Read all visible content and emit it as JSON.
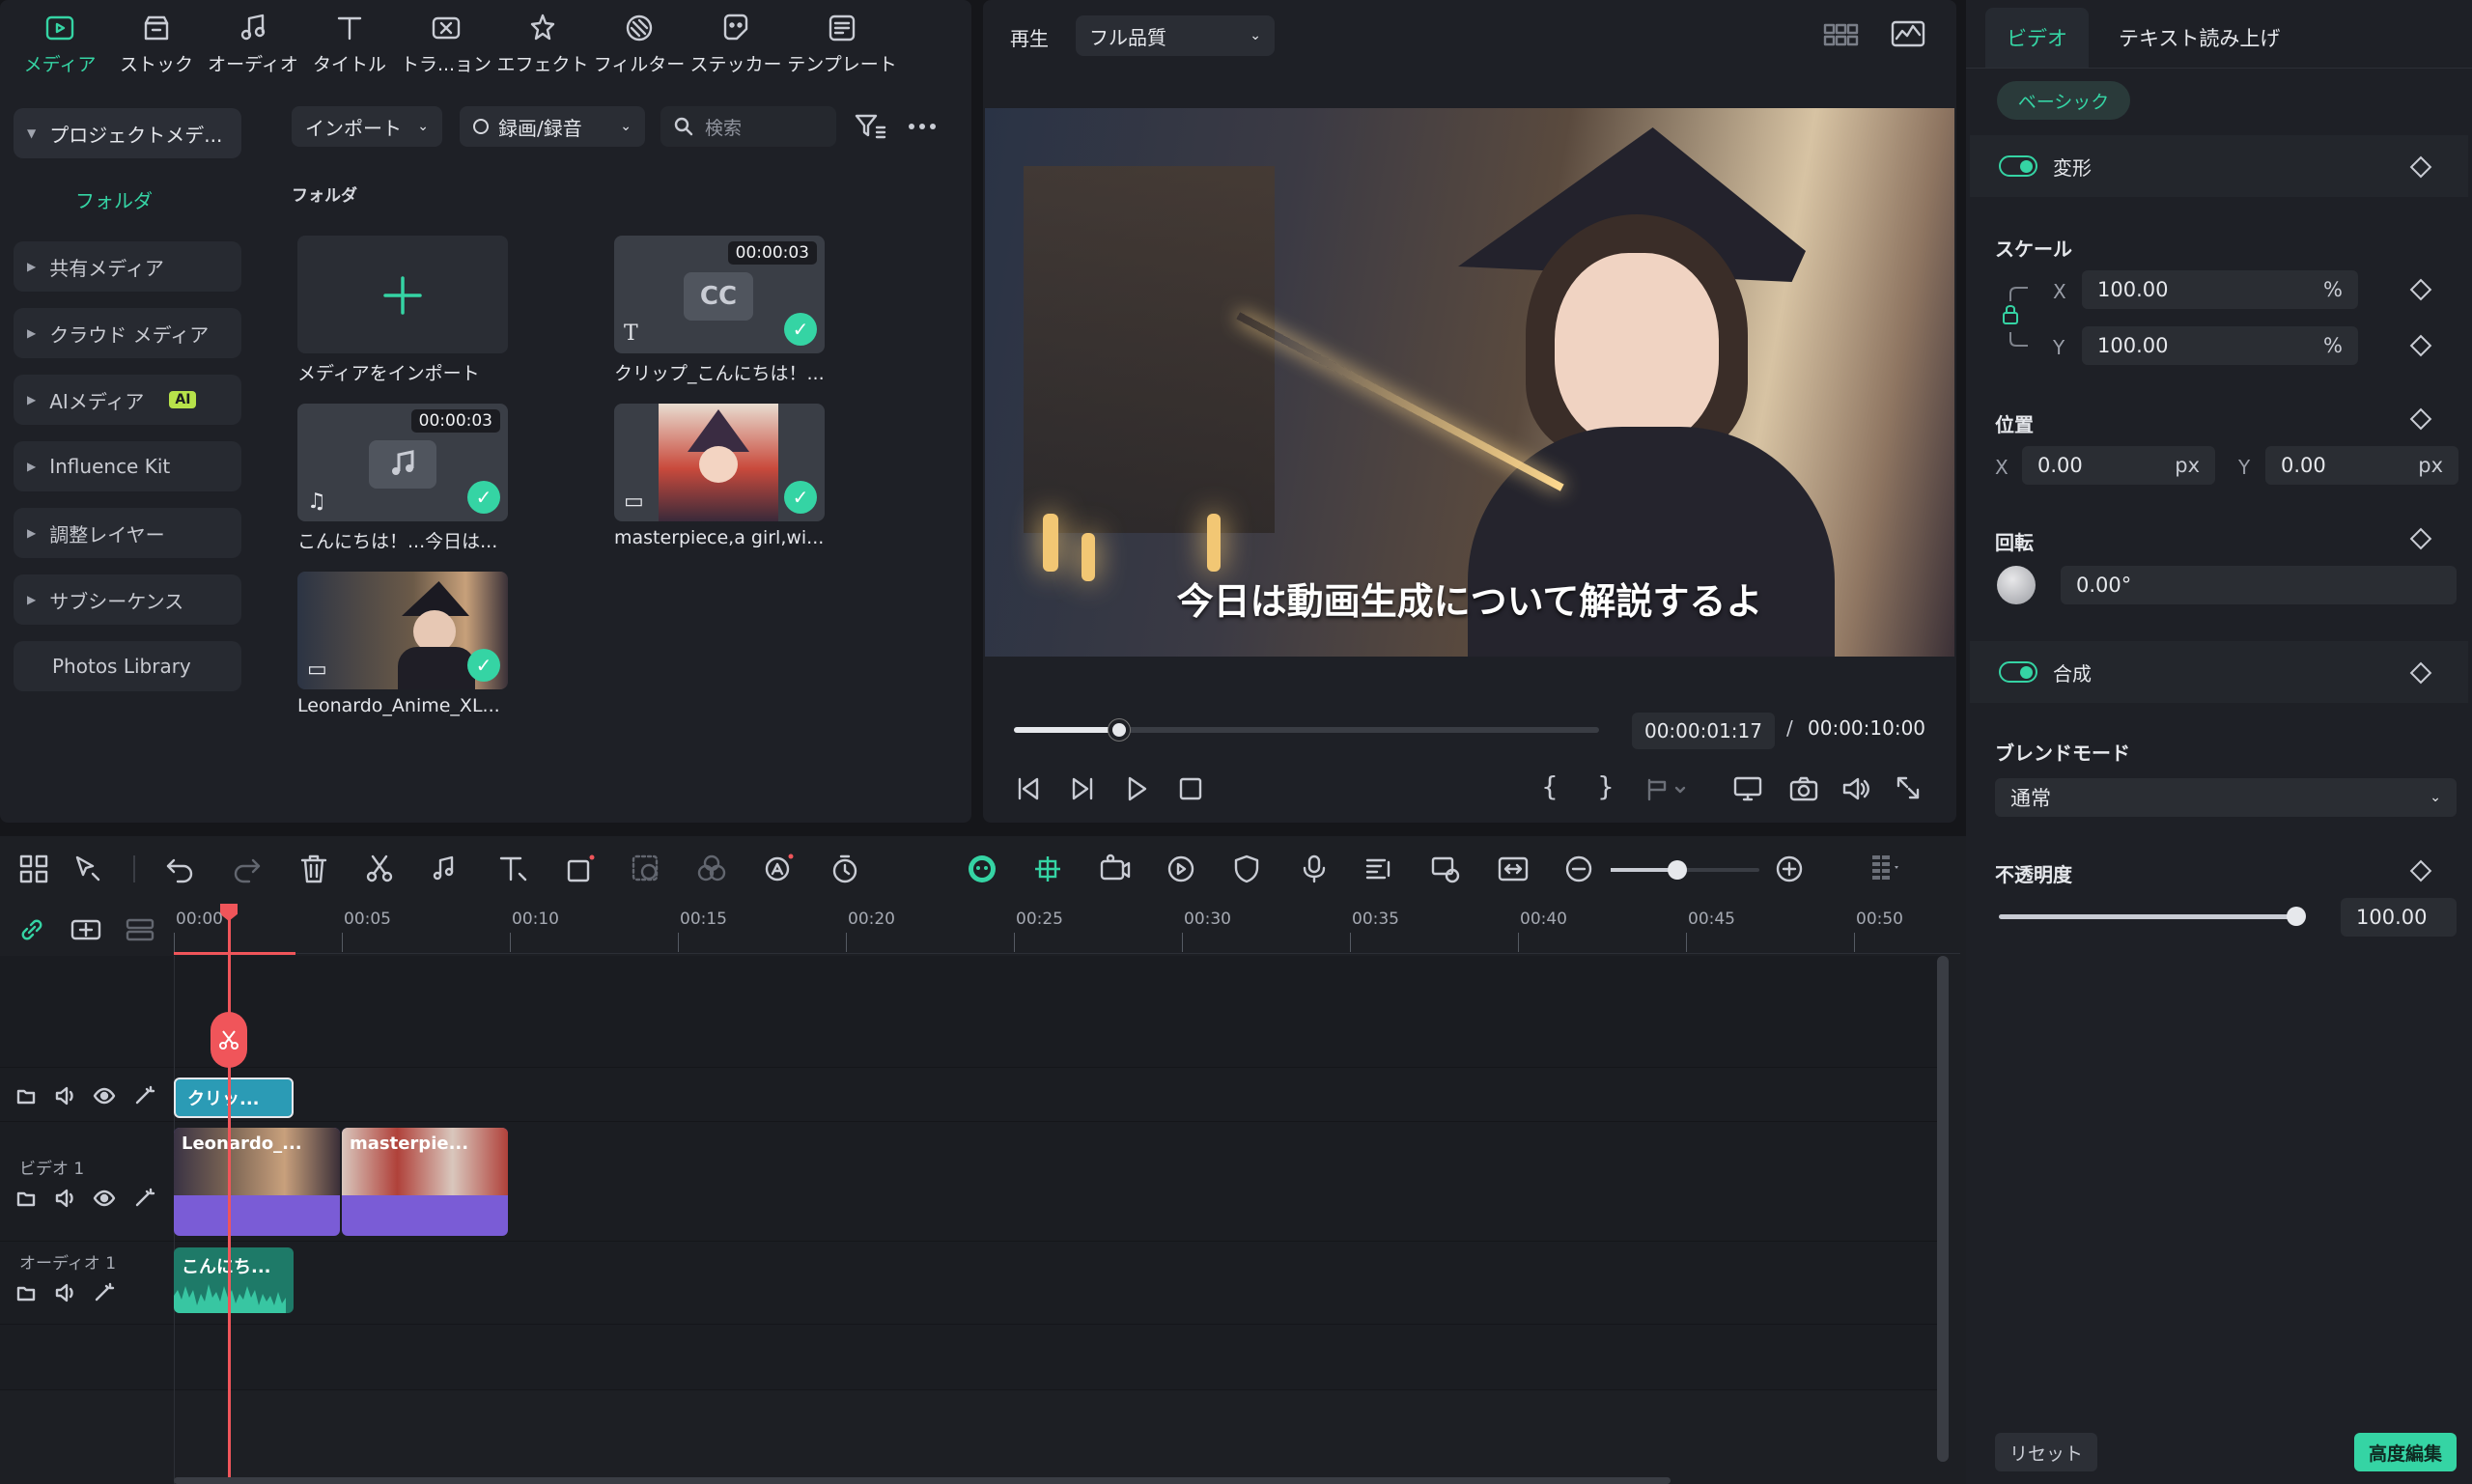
{
  "media_tabs": [
    {
      "label": "メディア",
      "icon": "media-icon"
    },
    {
      "label": "ストック",
      "icon": "stock-icon"
    },
    {
      "label": "オーディオ",
      "icon": "music-note-icon"
    },
    {
      "label": "タイトル",
      "icon": "title-t-icon"
    },
    {
      "label": "トラ...ョン",
      "icon": "transition-icon"
    },
    {
      "label": "エフェクト",
      "icon": "effect-star-icon"
    },
    {
      "label": "フィルター",
      "icon": "filter-icon"
    },
    {
      "label": "ステッカー",
      "icon": "sticker-icon"
    },
    {
      "label": "テンプレート",
      "icon": "template-icon"
    }
  ],
  "sidebar": {
    "project_media": "プロジェクトメデ...",
    "folder": "フォルダ",
    "items": [
      "共有メディア",
      "クラウド メディア",
      "AIメディア",
      "Influence Kit",
      "調整レイヤー",
      "サブシーケンス",
      "Photos Library"
    ],
    "ai_badge": "AI"
  },
  "media_toolbar": {
    "import": "インポート",
    "record": "録画/録音",
    "search_placeholder": "検索"
  },
  "folder_title": "フォルダ",
  "media_items": [
    {
      "label": "メディアをインポート"
    },
    {
      "label": "クリップ_こんにちは！...",
      "duration": "00:00:03",
      "cc": "CC",
      "type_glyph": "T"
    },
    {
      "label": "こんにちは！...今日は...",
      "duration": "00:00:03"
    },
    {
      "label": "masterpiece,a girl,wi..."
    },
    {
      "label": "Leonardo_Anime_XL..."
    }
  ],
  "preview": {
    "play_label": "再生",
    "quality": "フル品質",
    "subtitle": "今日は動画生成について解説するよ",
    "current_time": "00:00:01:17",
    "separator": "/",
    "total_time": "00:00:10:00",
    "progress": 0.18,
    "brace_open": "{",
    "brace_close": "}"
  },
  "props": {
    "tab_video": "ビデオ",
    "tab_tts": "テキスト読み上げ",
    "basic": "ベーシック",
    "transform": "変形",
    "scale": "スケール",
    "scale_x": "100.00",
    "scale_y": "100.00",
    "percent": "%",
    "x_label": "X",
    "y_label": "Y",
    "position": "位置",
    "pos_x": "0.00",
    "pos_y": "0.00",
    "px": "px",
    "rotation": "回転",
    "rotation_value": "0.00°",
    "composite": "合成",
    "blend_mode": "ブレンドモード",
    "blend_value": "通常",
    "opacity": "不透明度",
    "opacity_value": "100.00",
    "opacity_level": 1.0,
    "reset": "リセット",
    "advanced": "高度編集"
  },
  "timeline": {
    "ticks": [
      "00:00",
      "00:05",
      "00:10",
      "00:15",
      "00:20",
      "00:25",
      "00:30",
      "00:35",
      "00:40",
      "00:45",
      "00:50"
    ],
    "video_track": "ビデオ 1",
    "audio_track": "オーディオ 1",
    "clips": {
      "title": "クリッ...",
      "video1": "Leonardo_...",
      "video2": "masterpie...",
      "audio": "こんにち..."
    },
    "zoom_level": 0.45
  },
  "colors": {
    "accent": "#35d4a4",
    "playhead": "#f0555a",
    "video_clip": "#7a5cd6",
    "audio_clip": "#1e7a68",
    "title_clip": "#2b9bb5"
  }
}
